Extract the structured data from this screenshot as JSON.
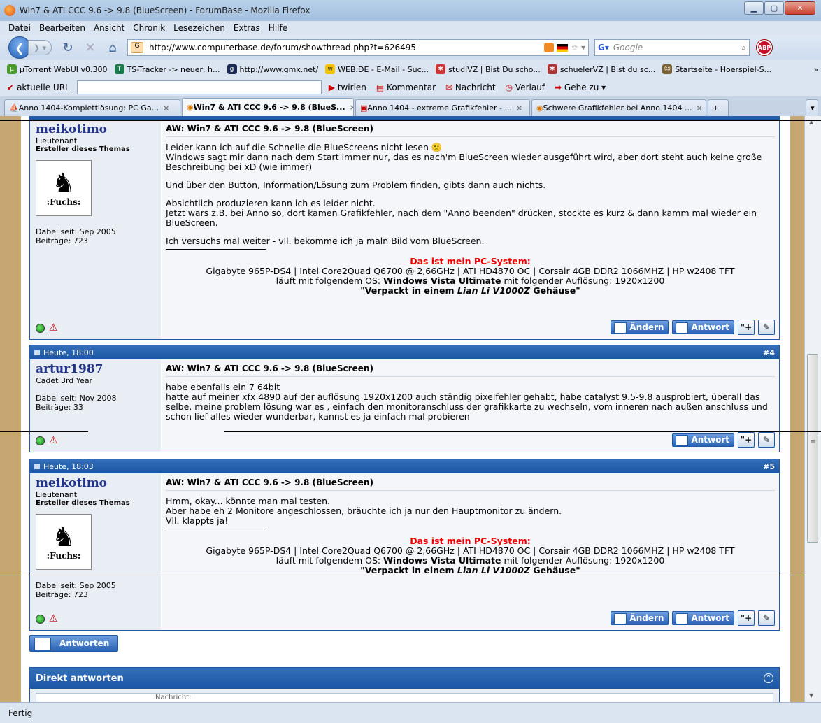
{
  "window": {
    "title": "Win7 & ATI CCC 9.6 -> 9.8 (BlueScreen) - ForumBase - Mozilla Firefox"
  },
  "menu": [
    "Datei",
    "Bearbeiten",
    "Ansicht",
    "Chronik",
    "Lesezeichen",
    "Extras",
    "Hilfe"
  ],
  "nav": {
    "url": "http://www.computerbase.de/forum/showthread.php?t=626495",
    "search_placeholder": "Google",
    "abp": "ABP"
  },
  "bookmarks": [
    "µTorrent WebUI v0.300",
    "TS-Tracker -> neuer, h...",
    "http://www.gmx.net/",
    "WEB.DE - E-Mail - Suc...",
    "studiVZ | Bist Du scho...",
    "schuelerVZ | Bist du sc...",
    "Startseite - Hoerspiel-S..."
  ],
  "toolbar2": {
    "label": "aktuelle URL",
    "twirlen": "twirlen",
    "kommentar": "Kommentar",
    "nachricht": "Nachricht",
    "verlauf": "Verlauf",
    "gehezu": "Gehe zu"
  },
  "tabs": [
    "Anno 1404-Komplettlösung: PC Ga...",
    "Win7 & ATI CCC 9.6 -> 9.8 (BlueS...",
    "Anno 1404 - extreme Grafikfehler - ...",
    "Schwere Grafikfehler bei Anno 1404 ..."
  ],
  "posts": [
    {
      "user": "meikotimo",
      "rank": "Lieutenant",
      "starter": "Ersteller dieses Themas",
      "avatar_text": ":Fuchs:",
      "joined": "Dabei seit: Sep 2005",
      "posts": "Beiträge: 723",
      "title": "AW: Win7 & ATI CCC 9.6 -> 9.8 (BlueScreen)",
      "p1": "Leider kann ich auf die Schnelle die BlueScreens nicht lesen 🙁",
      "p1b": "Windows sagt mir dann nach dem Start immer nur, das es nach'm BlueScreen wieder ausgeführt wird, aber dort steht auch keine große Beschreibung bei xD (wie immer)",
      "p2": "Und über den Button, Information/Lösung zum Problem finden, gibts dann auch nichts.",
      "p3": "Absichtlich produzieren kann ich es leider nicht.",
      "p3b": "Jetzt wars z.B. bei Anno so, dort kamen Grafikfehler, nach dem \"Anno beenden\" drücken, stockte es kurz & dann kamm mal wieder ein BlueScreen.",
      "p4": "Ich versuchs mal weiter - vll. bekomme ich ja maln Bild vom BlueScreen."
    },
    {
      "date": "Heute, 18:00",
      "num": "#4",
      "user": "artur1987",
      "rank": "Cadet 3rd Year",
      "joined": "Dabei seit: Nov 2008",
      "posts": "Beiträge: 33",
      "title": "AW: Win7 & ATI CCC 9.6 -> 9.8 (BlueScreen)",
      "p1": "habe ebenfalls ein 7 64bit",
      "p1b": "hatte auf meiner xfx 4890 auf der auflösung 1920x1200 auch ständig pixelfehler gehabt, habe catalyst 9.5-9.8 ausprobiert, überall das selbe, meine problem lösung war es , einfach den monitoranschluss der grafikkarte zu wechseln, vom inneren nach außen anschluss und schon lief alles wieder wunderbar, kannst es ja einfach mal probieren"
    },
    {
      "date": "Heute, 18:03",
      "num": "#5",
      "user": "meikotimo",
      "rank": "Lieutenant",
      "starter": "Ersteller dieses Themas",
      "avatar_text": ":Fuchs:",
      "joined": "Dabei seit: Sep 2005",
      "posts": "Beiträge: 723",
      "title": "AW: Win7 & ATI CCC 9.6 -> 9.8 (BlueScreen)",
      "p1": "Hmm, okay... könnte man mal testen.",
      "p1b": "Aber habe eh 2 Monitore angeschlossen, bräuchte ich ja nur den Hauptmonitor zu ändern.",
      "p1c": "Vll. klappts ja!"
    }
  ],
  "signature": {
    "head": "Das ist mein PC-System:",
    "line1": "Gigabyte 965P-DS4 | Intel Core2Quad Q6700 @ 2,66GHz | ATI HD4870 OC | Corsair 4GB DDR2 1066MHZ | HP w2408 TFT",
    "line2a": "läuft mit folgendem OS: ",
    "line2b": "Windows Vista Ultimate",
    "line2c": " mit folgender Auflösung: 1920x1200",
    "line3a": "\"Verpackt in einem ",
    "line3b": "Lian Li V1000Z",
    "line3c": " Gehäuse\""
  },
  "buttons": {
    "edit": "Ändern",
    "reply": "Antwort",
    "quote_multi": "\"+",
    "quote": "\"",
    "new_reply": "Antworten"
  },
  "quick_reply": {
    "title": "Direkt antworten",
    "body": "Nachricht:"
  },
  "status": "Fertig"
}
